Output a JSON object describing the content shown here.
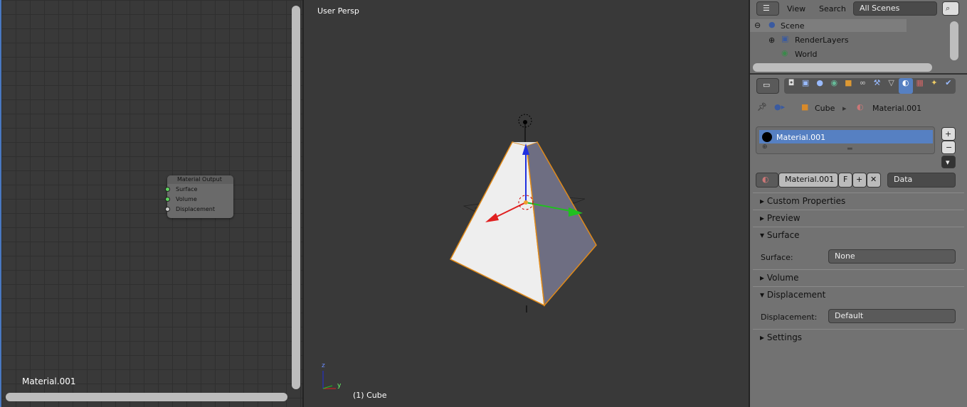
{
  "node_editor": {
    "material_name": "Material.001",
    "node": {
      "title": "Material Output",
      "sockets": [
        "Surface",
        "Volume",
        "Displacement"
      ]
    }
  },
  "viewport": {
    "view_label": "User Persp",
    "object_label": "(1) Cube",
    "axis_labels": {
      "x": "x",
      "y": "y",
      "z": "z"
    }
  },
  "outliner": {
    "menu_view": "View",
    "menu_search": "Search",
    "scene_filter": "All Scenes",
    "items": [
      "Scene",
      "RenderLayers",
      "World"
    ]
  },
  "properties": {
    "breadcrumb": {
      "object": "Cube",
      "material": "Material.001"
    },
    "material_slot": "Material.001",
    "material_field": "Material.001",
    "fake_user": "F",
    "link": "Data",
    "panels": {
      "custom_properties": "Custom Properties",
      "preview": "Preview",
      "surface": "Surface",
      "volume": "Volume",
      "displacement": "Displacement",
      "settings": "Settings"
    },
    "surface_label": "Surface:",
    "surface_value": "None",
    "displacement_label": "Displacement:",
    "displacement_value": "Default"
  }
}
